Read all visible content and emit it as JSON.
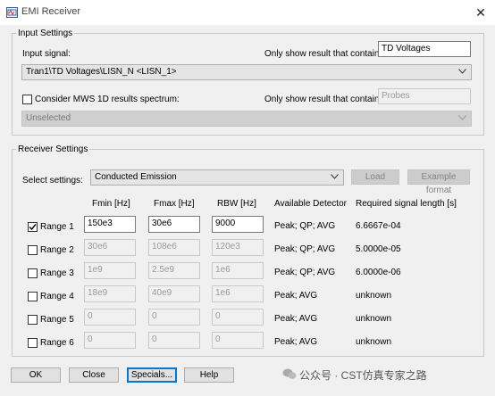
{
  "window": {
    "title": "EMI Receiver",
    "close_icon": "close-icon"
  },
  "input_settings": {
    "legend": "Input Settings",
    "input_signal_label": "Input signal:",
    "filter_label": "Only show result that contain:",
    "filter_value": "TD Voltages",
    "signal_value": "Tran1\\TD Voltages\\LISN_N <LISN_1>",
    "mws_label": "Consider MWS 1D results spectrum:",
    "mws_checked": false,
    "mws_filter_label": "Only show result that contain:",
    "mws_filter_value": "Probes",
    "mws_value": "Unselected"
  },
  "receiver_settings": {
    "legend": "Receiver Settings",
    "select_label": "Select settings:",
    "select_value": "Conducted Emission",
    "load_label": "Load",
    "example_label": "Example format",
    "headers": {
      "fmin": "Fmin [Hz]",
      "fmax": "Fmax [Hz]",
      "rbw": "RBW [Hz]",
      "detector": "Available Detector",
      "length": "Required signal length [s]"
    },
    "ranges": [
      {
        "label": "Range 1",
        "checked": true,
        "fmin": "150e3",
        "fmax": "30e6",
        "rbw": "9000",
        "detector": "Peak; QP; AVG",
        "length": "6.6667e-04"
      },
      {
        "label": "Range 2",
        "checked": false,
        "fmin": "30e6",
        "fmax": "108e6",
        "rbw": "120e3",
        "detector": "Peak; QP; AVG",
        "length": "5.0000e-05"
      },
      {
        "label": "Range 3",
        "checked": false,
        "fmin": "1e9",
        "fmax": "2.5e9",
        "rbw": "1e6",
        "detector": "Peak; QP; AVG",
        "length": "6.0000e-06"
      },
      {
        "label": "Range 4",
        "checked": false,
        "fmin": "18e9",
        "fmax": "40e9",
        "rbw": "1e6",
        "detector": "Peak; AVG",
        "length": "unknown"
      },
      {
        "label": "Range 5",
        "checked": false,
        "fmin": "0",
        "fmax": "0",
        "rbw": "0",
        "detector": "Peak; AVG",
        "length": "unknown"
      },
      {
        "label": "Range 6",
        "checked": false,
        "fmin": "0",
        "fmax": "0",
        "rbw": "0",
        "detector": "Peak; AVG",
        "length": "unknown"
      }
    ]
  },
  "footer": {
    "ok": "OK",
    "close": "Close",
    "specials": "Specials...",
    "help": "Help"
  },
  "watermark": {
    "text": "公众号 · CST仿真专家之路"
  }
}
